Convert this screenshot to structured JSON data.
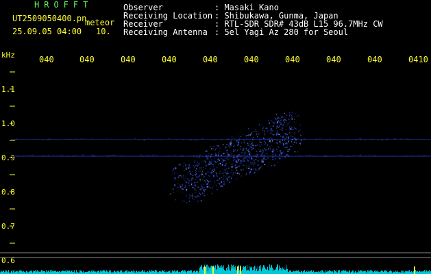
{
  "header": {
    "brand": "HROFFT",
    "filename": "UT2509050400.pn",
    "mode": "meteor",
    "datetime": "25.09.05 04:00",
    "interval": "10.",
    "fields": [
      {
        "label": "Observer",
        "value": ": Masaki Kano"
      },
      {
        "label": "Receiving Location",
        "value": ": Shibukawa, Gunma, Japan"
      },
      {
        "label": "Receiver",
        "value": ": RTL-SDR SDR# 43dB L15 96.7MHz CW"
      },
      {
        "label": "Receiving Antenna",
        "value": ": 5el Yagi Az 280 for Seoul"
      }
    ]
  },
  "axis": {
    "unit_label": "kHz",
    "time_ticks": [
      "040",
      "040",
      "040",
      "040",
      "040",
      "040",
      "040",
      "040",
      "040",
      "0410"
    ],
    "freq_ticks": [
      "1.1",
      "1.0",
      "0.9",
      "0.8",
      "0.7",
      "0.6"
    ]
  },
  "colors": {
    "background": "#000000",
    "text_header": "#ffffff",
    "text_brand": "#5cff5c",
    "axis_labels": "#ffff33",
    "signal": "#3a5cff",
    "noise_band": "#1a2a7a",
    "level_bar": "#00c8d8",
    "meteor_marker": "#ffff33"
  }
}
